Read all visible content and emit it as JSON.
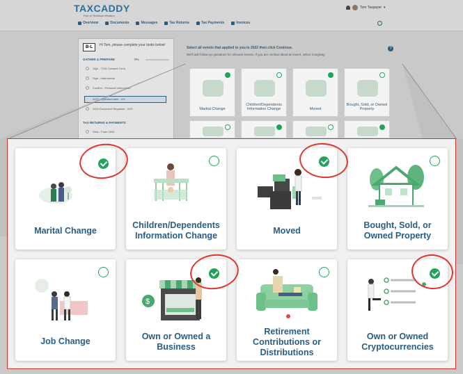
{
  "header": {
    "logo": "TAXCADDY",
    "logo_sub": "Part of Thomson Reuters",
    "user_name": "Tom Taxpayer",
    "nav": [
      "Overview",
      "Documents",
      "Messages",
      "Tax Returns",
      "Tax Payments",
      "Invoices"
    ]
  },
  "sidebar": {
    "greeting": "Hi Tom, please complete your tasks below!",
    "section1": "GATHER & PREPARE",
    "progress": "0%",
    "items": [
      "Sign - 7216 Consent Form",
      "Sign - Instructions",
      "Confirm - Personal Information",
      "2022 - Questionnaire - 0%",
      "2022 Document Requests - 0/33"
    ],
    "section2": "TAX RETURNS & PAYMENTS",
    "items2": [
      "View - Form 1040"
    ]
  },
  "main": {
    "title": "Select all events that applied to you in 2022 then click Continue.",
    "subtitle": "We'll ask follow-up questions for relevant events. If you are unclear about an event, select it anyway."
  },
  "cards": [
    {
      "title": "Marital Change",
      "checked": true,
      "icon": "couple-illustration"
    },
    {
      "title": "Children/Dependents Information Change",
      "checked": false,
      "icon": "parent-child-illustration"
    },
    {
      "title": "Moved",
      "checked": true,
      "icon": "moving-boxes-illustration"
    },
    {
      "title": "Bought, Sold, or Owned Property",
      "checked": false,
      "icon": "house-illustration"
    },
    {
      "title": "Job Change",
      "checked": false,
      "icon": "office-handshake-illustration"
    },
    {
      "title": "Own or Owned a Business",
      "checked": true,
      "icon": "storefront-illustration"
    },
    {
      "title": "Retirement Contributions or Distributions",
      "checked": false,
      "icon": "sofa-relaxing-illustration"
    },
    {
      "title": "Own or Owned Cryptocurrencies",
      "checked": true,
      "icon": "crypto-illustration"
    }
  ],
  "colors": {
    "accent": "#2a5d86",
    "check": "#22a35a",
    "highlight": "#e0342f"
  }
}
